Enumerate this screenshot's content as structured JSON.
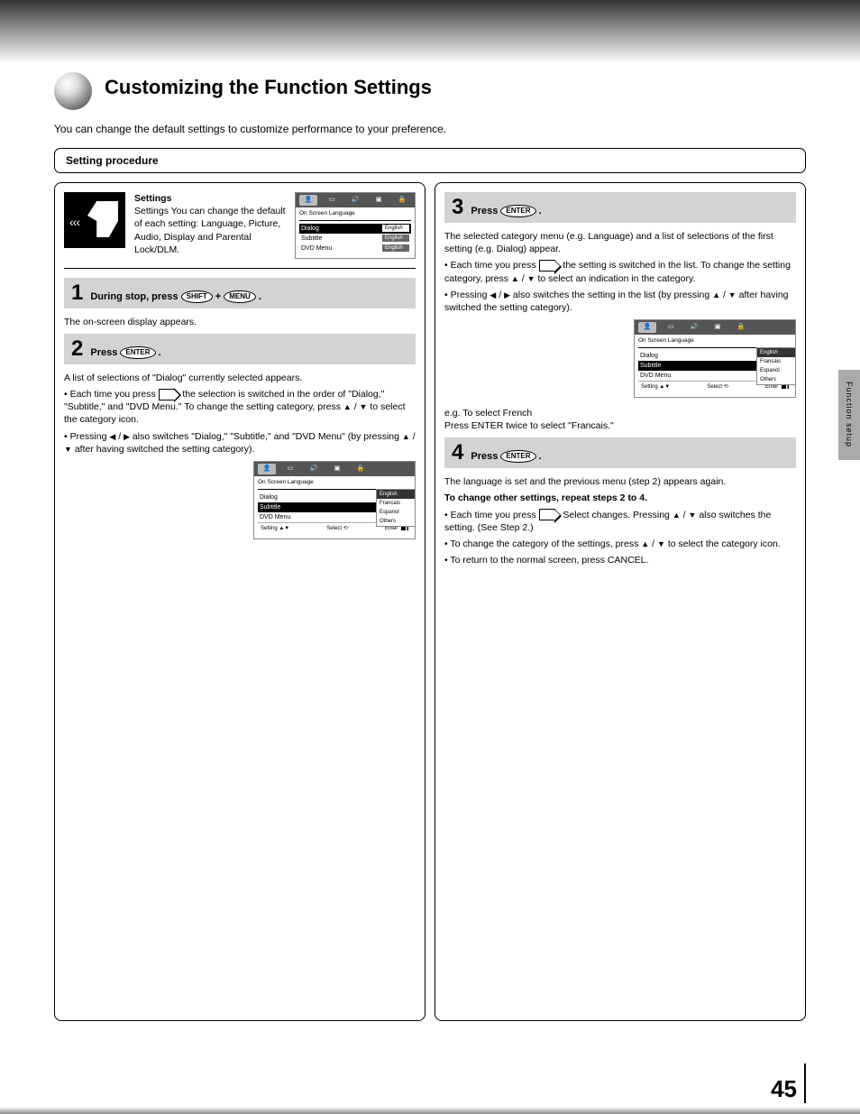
{
  "title": "Customizing the Function Settings",
  "lead": "You can change the default settings to customize performance to your preference.",
  "section": "Setting procedure",
  "page_number": "45",
  "side_tab": "Function setup",
  "settings_intro": "Settings\nYou can change the default of each setting: Language, Picture, Audio, Display and Parental Lock/DLM.",
  "osd": {
    "section_label": "On Screen Language",
    "rows": [
      {
        "label": "Dialog",
        "value": "English"
      },
      {
        "label": "Subtitle",
        "value": "English"
      },
      {
        "label": "DVD Menu",
        "value": "English"
      }
    ],
    "tabs": [
      "lang",
      "pic",
      "aud",
      "disp",
      "lock"
    ]
  },
  "left": {
    "step1": {
      "num": "1",
      "text_a": "During stop, press ",
      "btn1": "SHIFT",
      "text_b": " + ",
      "btn2": "MENU",
      "text_c": "."
    },
    "step1_desc": "The on-screen display appears.",
    "step2": {
      "num": "2",
      "text_a": "Press ",
      "btn": "ENTER",
      "text_b": "."
    },
    "step2_desc": "A list of selections of \"Dialog\" currently selected appears.",
    "bullets_a": "• Each time you press ",
    "bullets_a2": ", the selection is switched in the order of \"Dialog,\" \"Subtitle,\" and \"DVD Menu.\" To change the setting category, press ",
    "bullets_a3": " / ",
    "bullets_a4": " to select the category icon.",
    "bullets_b": "• Pressing ",
    "bullets_b2": " / ",
    "bullets_b3": " also switches \"Dialog,\" \"Subtitle,\" and \"DVD Menu\" (by pressing ",
    "bullets_b4": " / ",
    "bullets_b5": " after having switched the setting category).",
    "osd2": {
      "section": "On Screen Language",
      "row1": "Dialog",
      "row2": "Subtitle",
      "row3": "DVD Menu",
      "val": "English",
      "opts": [
        "English",
        "Francais",
        "Espanol",
        "Others"
      ],
      "tabs": [
        "Setting",
        "Select",
        "Enter"
      ]
    }
  },
  "right": {
    "step3": {
      "num": "3",
      "text_a": "Press ",
      "btn": "ENTER",
      "text_b": "."
    },
    "step3_desc1": "The selected category menu (e.g. Language) and a list of selections of the first setting (e.g. Dialog) appear.",
    "step3_bul_a": "• Each time you press ",
    "step3_bul_a2": ", the setting is switched in the list. To change the setting category, press ",
    "step3_bul_a3": " / ",
    "step3_bul_a4": " to select an indication in the category.",
    "step3_bul_b": "• Pressing ",
    "step3_bul_b2": " / ",
    "step3_bul_b3": " also switches the setting in the list (by pressing ",
    "step3_bul_b4": " / ",
    "step3_bul_b5": " after having switched the setting category).",
    "osd3": {
      "section": "On Screen Language",
      "row1": "Dialog",
      "row2": "Subtitle",
      "row3": "DVD Menu",
      "val": "English",
      "opts": [
        "English",
        "Francais",
        "Espanol",
        "Others"
      ],
      "tabs": [
        "Setting",
        "Select",
        "Enter"
      ]
    },
    "step3_note": "e.g. To select French\nPress ENTER twice to select \"Francais.\"",
    "step4": {
      "num": "4",
      "text_a": "Press ",
      "btn": "ENTER",
      "text_b": "."
    },
    "step4_desc1": "The language is set and the previous menu (step 2) appears again.",
    "step4_desc2": "To change other settings, repeat steps 2 to 4.",
    "step4_bul_a": "• Each time you press ",
    "step4_bul_a2": ", Select changes. Pressing ",
    "step4_bul_a3": " / ",
    "step4_bul_a4": " also switches the setting. (See Step 2.)",
    "step4_bul_b": "• To change the category of the settings, press ",
    "step4_bul_b2": " / ",
    "step4_bul_b3": " to select the category icon.",
    "step4_bul_c": "• To return to the normal screen, press CANCEL."
  }
}
